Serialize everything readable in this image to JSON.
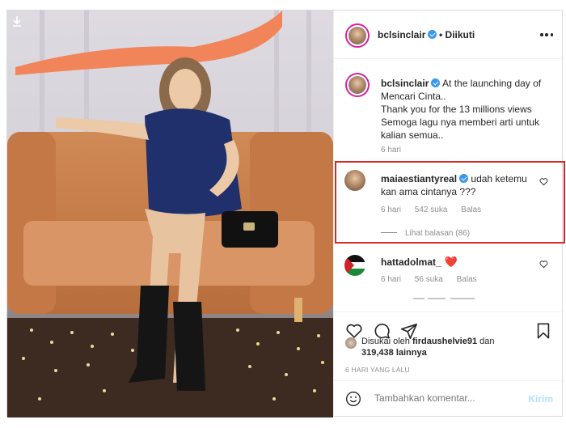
{
  "header": {
    "username": "bclsinclair",
    "follow_status": "• Diikuti"
  },
  "caption": {
    "username": "bclsinclair",
    "text_line1": "At the launching day of",
    "text_line2": "Mencari Cinta..",
    "text_line3": "Thank you for the 13 millions views",
    "text_line4": "Semoga lagu nya memberi arti untuk",
    "text_line5": "kalian semua..",
    "time": "6 hari"
  },
  "comments": [
    {
      "username": "maiaestiantyreal",
      "text": "udah ketemu kan ama cintanya ???",
      "time": "6 hari",
      "likes": "542 suka",
      "reply": "Balas",
      "view_replies": "Lihat balasan (86)"
    },
    {
      "username": "hattadolmat_",
      "text": "❤️",
      "time": "6 hari",
      "likes": "56 suka",
      "reply": "Balas"
    }
  ],
  "likes": {
    "prefix": "Disukai oleh",
    "user": "firdaushelvie91",
    "mid": "dan",
    "count": "319,438 lainnya"
  },
  "post_date": "6 HARI YANG LALU",
  "add_comment": {
    "placeholder": "Tambahkan komentar...",
    "post_label": "Kirim"
  },
  "colors": {
    "highlight": "#d32a2a",
    "verified": "#3897f0",
    "post_button": "#b2dffc"
  }
}
